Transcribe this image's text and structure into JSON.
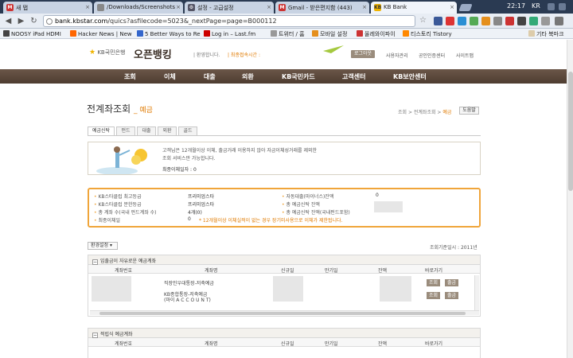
{
  "browser": {
    "tabs": [
      {
        "label": "새 탭",
        "icon": "gmail-icon"
      },
      {
        "label": "/Downloads/Screenshots",
        "icon": "file-icon"
      },
      {
        "label": "설정 - 고급설정",
        "icon": "settings-icon"
      },
      {
        "label": "Gmail - 받은편지함 (443)",
        "icon": "gmail-icon"
      },
      {
        "label": "KB Bank",
        "icon": "kb-icon"
      }
    ],
    "clock": "22:17",
    "locale": "KR",
    "url_domain": "bank.kbstar.com",
    "url_path": "/quics?asfilecode=5023&_nextPage=page=B000112",
    "bookmarks": [
      "NOOSY iPad HDMI",
      "Hacker News | New",
      "5 Better Ways to Re",
      "Log in – Last.fm",
      "트위터 / 홈",
      "모바일 설정",
      "올레와이파이",
      "티스토리 Tistory",
      "기타 북마크"
    ]
  },
  "header": {
    "logo_text": "KB국민은행",
    "title": "오픈뱅킹",
    "welcome": "| 환영합니다.",
    "last_login_label": "| 최종접속시간 :",
    "logout": "로그아웃",
    "top_links": [
      "사용자관리",
      "공인인증센터",
      "사이트맵"
    ]
  },
  "gnb": [
    "조회",
    "이체",
    "대출",
    "외환",
    "KB국민카드",
    "고객센터",
    "KB보안센터"
  ],
  "page": {
    "title": "전계좌조회",
    "subtitle": "예금",
    "breadcrumb": [
      "조회",
      "전계좌조회",
      "예금"
    ],
    "help": "도움말",
    "subtabs": [
      "예금신탁",
      "펀드",
      "대출",
      "외환",
      "골드"
    ]
  },
  "info": {
    "line1": "고객님은 12개월이상 이체, 출금거래 이용하지 않아 자금이체성거래를 제외한",
    "line2": "조회 서비스만 가능합니다.",
    "count": "최종이체일자 : 0"
  },
  "summary": {
    "left_labels": [
      "KB스타클럽 최고등급",
      "KB스타클럽 분한등급",
      "총 계좌 수(국내 펀드계좌 수)",
      "최종이체일"
    ],
    "left_values": [
      "프리미엄스타",
      "프리미엄스타",
      "4개(0)",
      "0"
    ],
    "right_labels": [
      "자동대출(마이너스)잔액",
      "총 예금신탁 잔액",
      "총 예금신탁 잔액(국내펀드포함)"
    ],
    "right_values": [
      "0",
      "",
      ""
    ],
    "warning": "* 12개월이상 이체실적이 없는 경우 장기미사용으로 이체가 제한됩니다."
  },
  "env": "환경설정",
  "inquiry_date": "조회기준일시 : 2011년",
  "section1": {
    "title": "입출금이 자유로운 예금계좌",
    "headers": [
      "계좌번호",
      "계좌명",
      "신규일",
      "만기일",
      "잔액",
      "바로가기"
    ],
    "rows": [
      {
        "name": "직장인우대통장-저축예금",
        "btn1": "조회",
        "btn2": "출금"
      },
      {
        "name": "KB종합통장-저축예금",
        "name2": "(마이 A C C O U N T)",
        "btn1": "조회",
        "btn2": "출금"
      }
    ]
  },
  "section2": {
    "title": "적립식 예금계좌",
    "headers": [
      "계좌번호",
      "계좌명",
      "신규일",
      "만기일",
      "잔액",
      "바로가기"
    ]
  }
}
